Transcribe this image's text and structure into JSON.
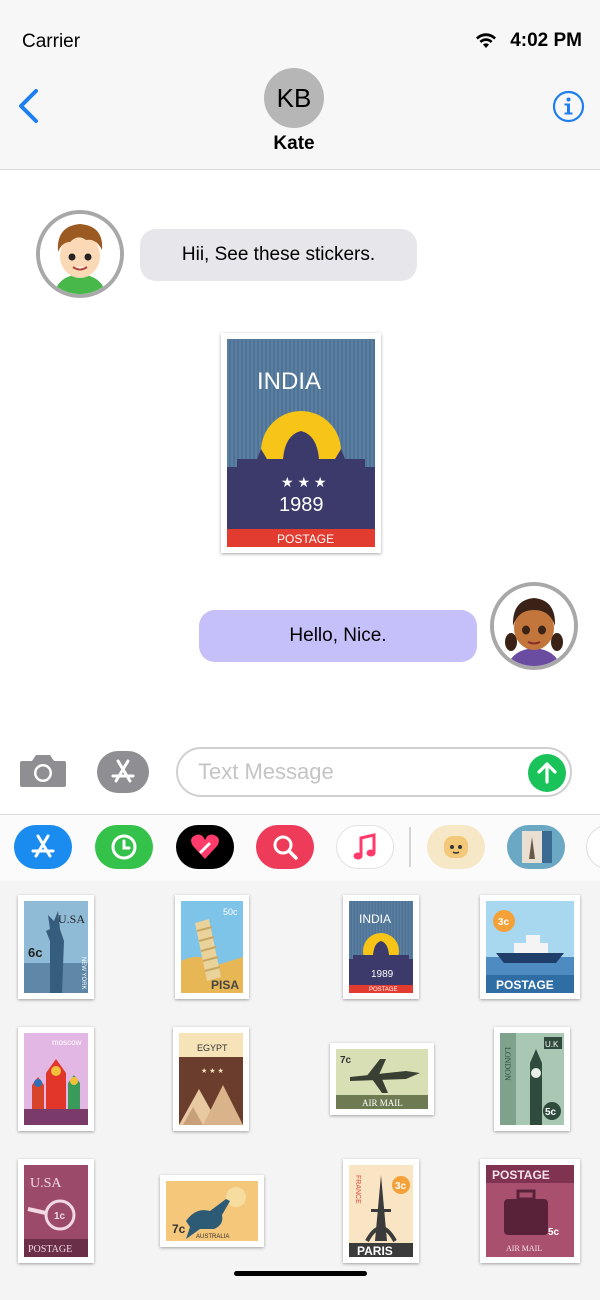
{
  "status_bar": {
    "carrier": "Carrier",
    "time": "4:02 PM",
    "wifi_icon": "wifi-icon"
  },
  "nav": {
    "back_icon": "chevron-left-icon",
    "avatar_initials": "KB",
    "contact_name": "Kate",
    "info_icon": "info-icon",
    "accent": "#1e7ff0"
  },
  "messages": [
    {
      "direction": "incoming",
      "text": "Hii, See these stickers.",
      "sender_avatar": "boy-avatar"
    },
    {
      "direction": "incoming",
      "type": "sticker",
      "sticker": "India stamp"
    },
    {
      "direction": "outgoing",
      "text": "Hello, Nice.",
      "sender_avatar": "girl-avatar"
    }
  ],
  "stickers": {
    "india": {
      "title": "INDIA",
      "year": "1989",
      "footer": "POSTAGE"
    },
    "usa_ny": {
      "title": "U.SA",
      "value": "6c",
      "side": "NEW YORK"
    },
    "pisa": {
      "value": "50c",
      "name": "PISA"
    },
    "ship": {
      "value": "3c",
      "label": "POSTAGE"
    },
    "moscow": {
      "name": "moscow"
    },
    "egypt": {
      "name": "EGYPT"
    },
    "airmail": {
      "value": "7c",
      "label": "AIR MAIL"
    },
    "london": {
      "corner": "U.K",
      "side": "LONDON",
      "value": "5c"
    },
    "usa_horn": {
      "title": "U.SA",
      "value": "1c",
      "label": "POSTAGE"
    },
    "australia": {
      "value": "7c",
      "name": "AUSTRALIA"
    },
    "paris": {
      "side": "FRANCE",
      "value": "3c",
      "name": "PARIS"
    },
    "suitcase": {
      "title": "POSTAGE",
      "value": "5c",
      "label": "AIR MAIL"
    }
  },
  "composer": {
    "camera_icon": "camera-icon",
    "appstore_icon": "app-store-icon",
    "placeholder": "Text Message",
    "send_icon": "send-arrow-icon",
    "send_color": "#19c35a"
  },
  "app_drawer": {
    "apps": [
      "app-store",
      "recents",
      "digital-touch",
      "image-search",
      "music",
      "sticker-pack-1",
      "sticker-pack-2"
    ]
  }
}
